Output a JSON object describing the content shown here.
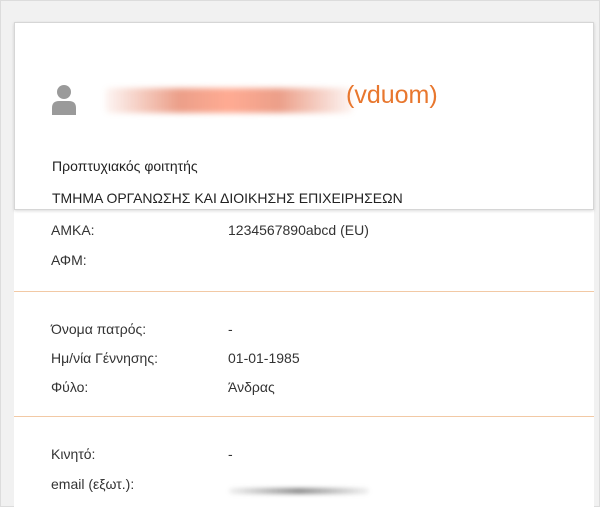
{
  "profile": {
    "username": "(vduom)",
    "role": "Προπτυχιακός φοιτητής",
    "department": "ΤΜΗΜΑ ΟΡΓΑΝΩΣΗΣ ΚΑΙ ΔΙΟΙΚΗΣΗΣ ΕΠΙΧΕΙΡΗΣΕΩΝ",
    "avatar_icon": "user-silhouette-icon",
    "accent_color": "#e8772e"
  },
  "ids": [
    {
      "label": "ΑΜΚΑ:",
      "value": "1234567890abcd (EU)"
    },
    {
      "label": "ΑΦΜ:",
      "value": ""
    }
  ],
  "personal": [
    {
      "label": "Όνομα πατρός:",
      "value": "-"
    },
    {
      "label": "Ημ/νία Γέννησης:",
      "value": "01-01-1985"
    },
    {
      "label": "Φύλο:",
      "value": "Άνδρας"
    }
  ],
  "contact": [
    {
      "label": "Κινητό:",
      "value": "-"
    },
    {
      "label": "email (εξωτ.):",
      "value": ""
    }
  ]
}
